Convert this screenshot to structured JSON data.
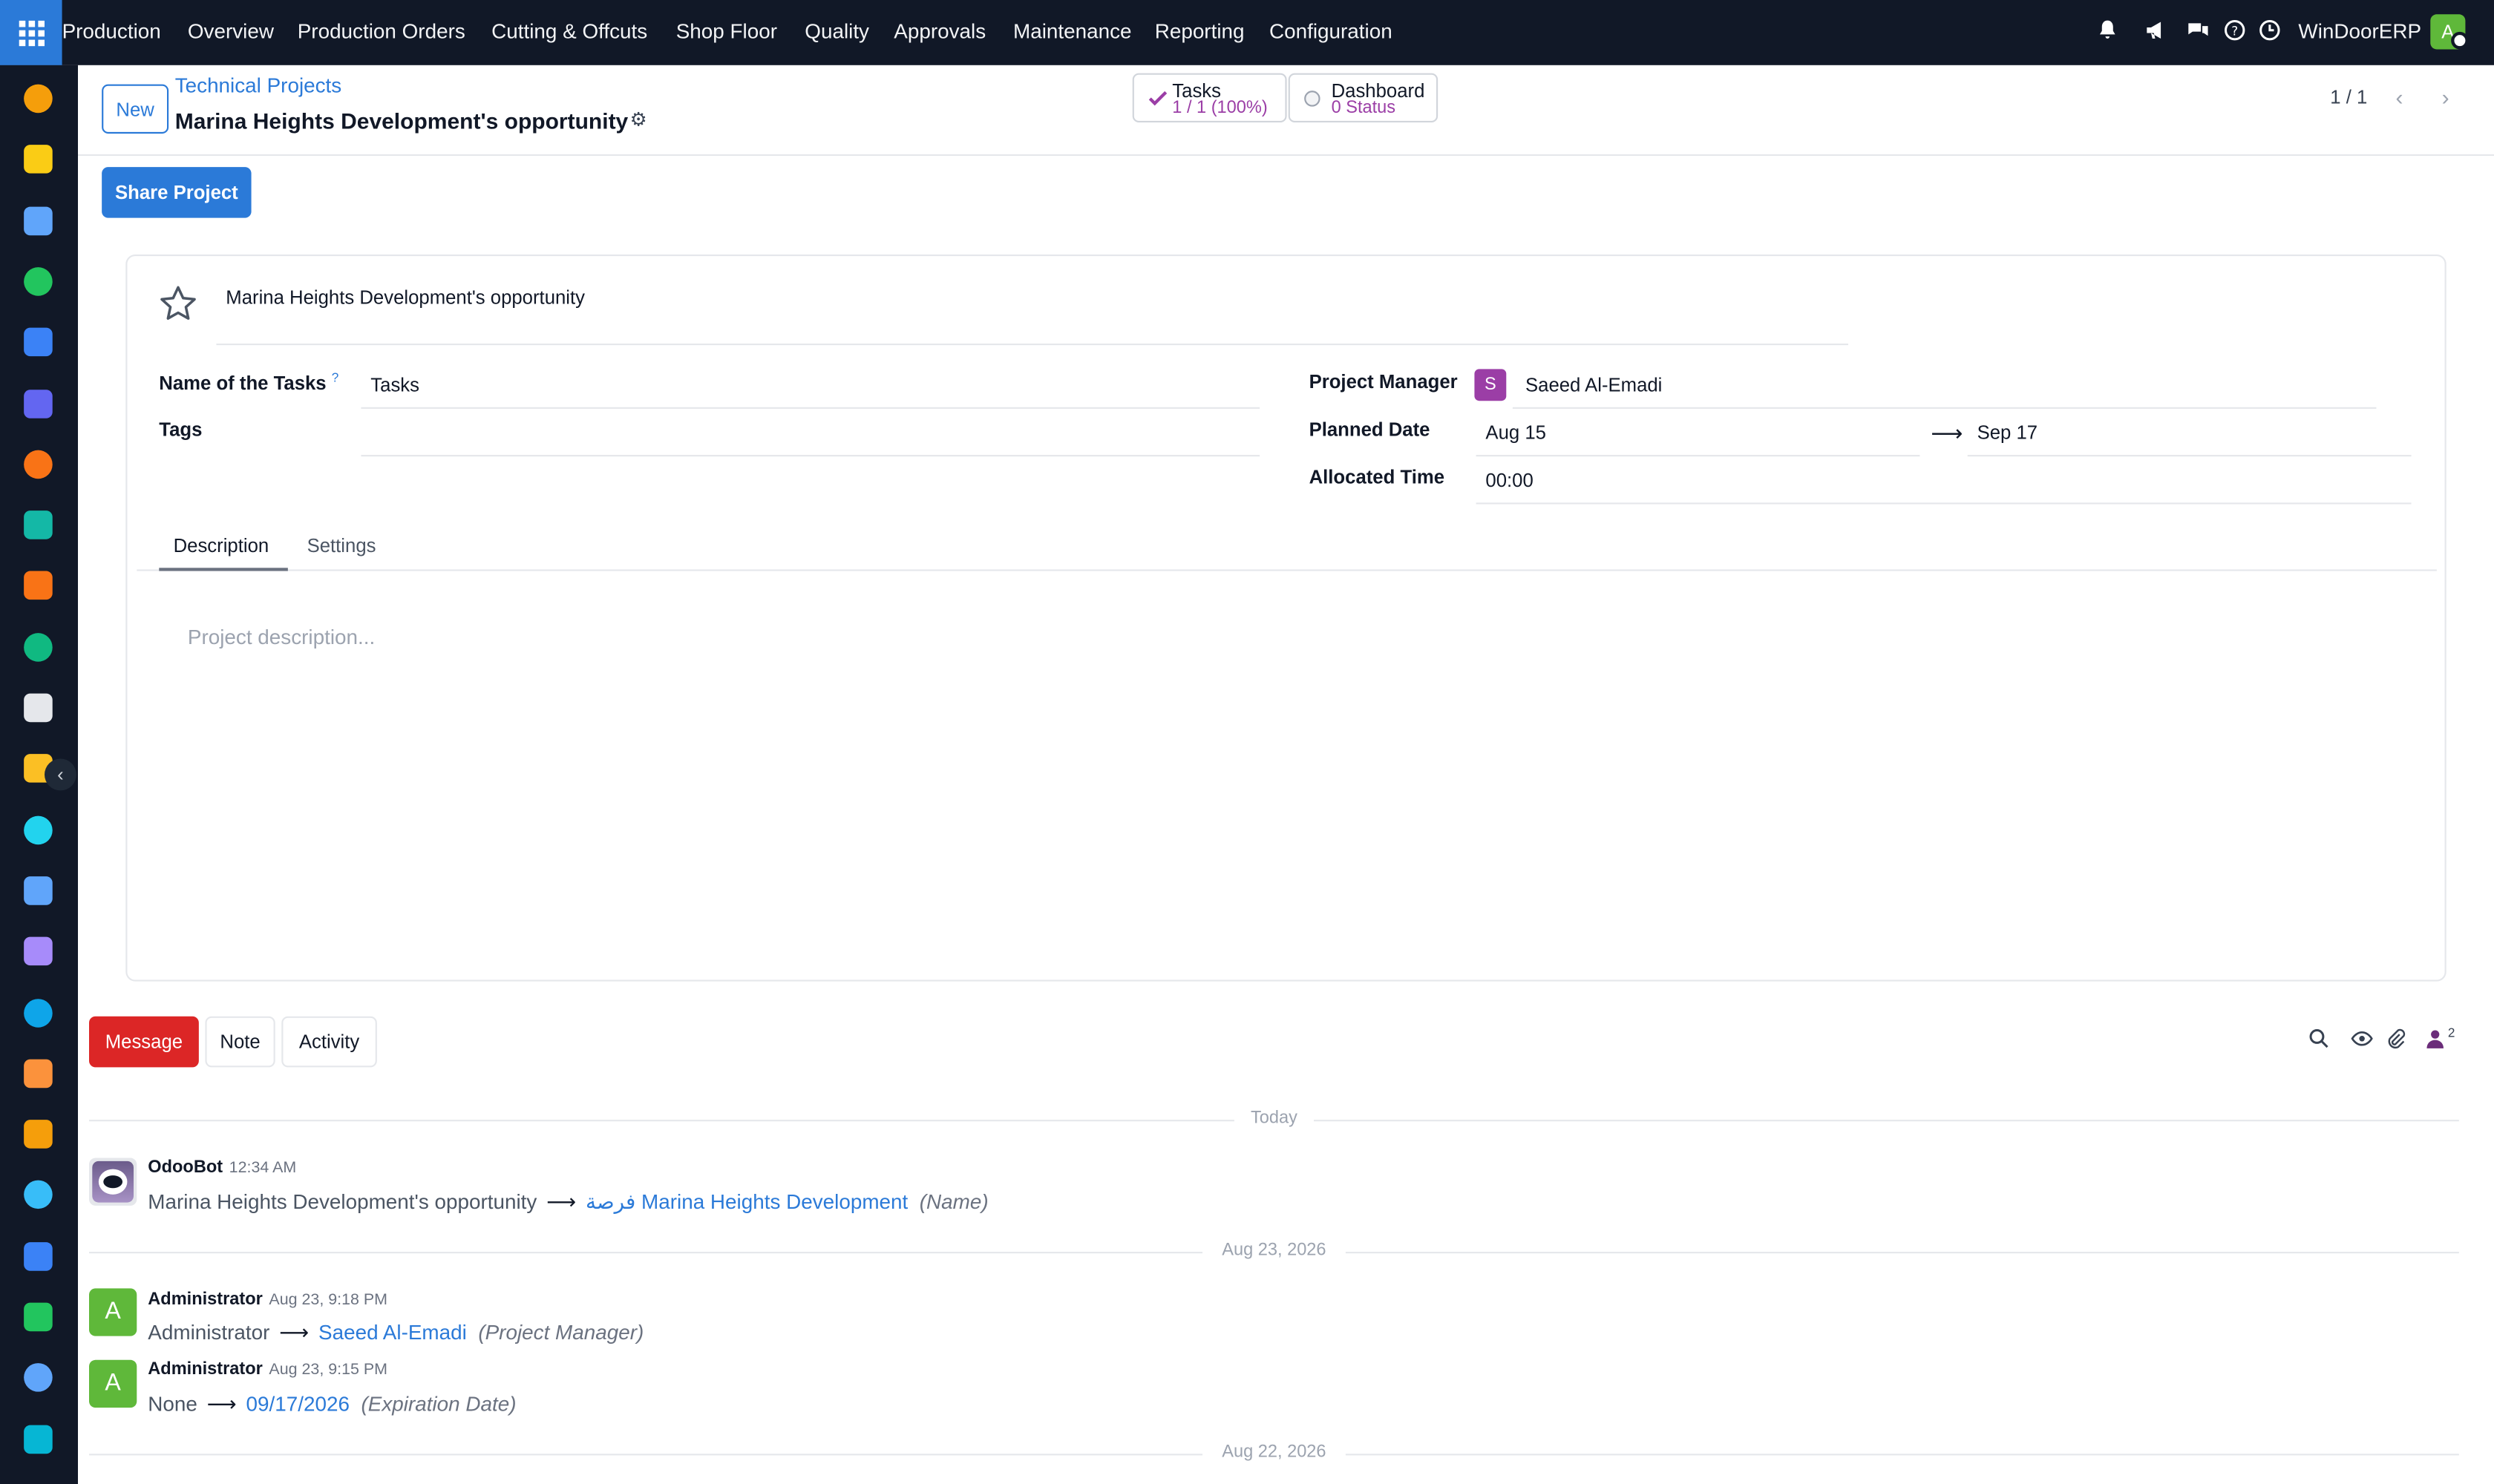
{
  "topbar": {
    "app_name": "Production",
    "menu": [
      "Overview",
      "Production Orders",
      "Cutting & Offcuts",
      "Shop Floor",
      "Quality",
      "Approvals",
      "Maintenance",
      "Reporting",
      "Configuration"
    ],
    "company": "WinDoorERP",
    "user_initial": "A",
    "icons": [
      "bell-icon",
      "megaphone-icon",
      "chat-icon",
      "help-icon",
      "clock-icon"
    ]
  },
  "sidebar": {
    "icons": [
      "bar-chart-icon",
      "paper-plane-icon",
      "compass-icon",
      "whatsapp-icon",
      "dashboard-icon",
      "m-app-icon",
      "chat-bubble-icon",
      "diamond-icon",
      "chart-icon",
      "contacts-icon",
      "box-icon",
      "puzzle-icon",
      "check-icon",
      "book-icon",
      "cube-icon",
      "invoice-icon",
      "team-icon",
      "calendar-icon",
      "sign-icon",
      "grid-icon",
      "whatsapp-icon",
      "compass-icon",
      "wave-icon"
    ],
    "colors": [
      "#f59e0b",
      "#facc15",
      "#60a5fa",
      "#22c55e",
      "#3b82f6",
      "#6366f1",
      "#f97316",
      "#14b8a6",
      "#f97316",
      "#10b981",
      "#e5e7eb",
      "#fbbf24",
      "#22d3ee",
      "#60a5fa",
      "#a78bfa",
      "#0ea5e9",
      "#fb923c",
      "#f59e0b",
      "#38bdf8",
      "#3b82f6",
      "#22c55e",
      "#60a5fa",
      "#06b6d4"
    ],
    "toggle_glyph": "‹"
  },
  "control_panel": {
    "new_label": "New",
    "breadcrumb": "Technical Projects",
    "title": "Marina Heights Development's opportunity",
    "smart_buttons": [
      {
        "label": "Tasks",
        "value": "1 / 1 (100%)"
      },
      {
        "label": "Dashboard",
        "value": "0 Status"
      }
    ],
    "pager": "1 / 1"
  },
  "actions": {
    "share_label": "Share Project"
  },
  "form": {
    "project_name": "Marina Heights Development's opportunity",
    "fields": {
      "tasks_label": "Name of the Tasks",
      "tasks_help": "?",
      "tasks_value": "Tasks",
      "tags_label": "Tags",
      "tags_value": "",
      "manager_label": "Project Manager",
      "manager_initial": "S",
      "manager_value": "Saeed Al-Emadi",
      "planned_label": "Planned Date",
      "planned_start": "Aug 15",
      "planned_end": "Sep 17",
      "allocated_label": "Allocated Time",
      "allocated_value": "00:00"
    },
    "tabs": [
      "Description",
      "Settings"
    ],
    "description_placeholder": "Project description..."
  },
  "chatter": {
    "buttons": [
      "Message",
      "Note",
      "Activity"
    ],
    "follower_count": "2",
    "separators": [
      "Today",
      "Aug 23, 2026",
      "Aug 22, 2026"
    ],
    "messages": [
      {
        "author": "OdooBot",
        "date": "12:34 AM",
        "old": "Marina Heights Development's opportunity",
        "new": "فرصة Marina Heights Development",
        "field": "(Name)"
      },
      {
        "author": "Administrator",
        "initial": "A",
        "date": "Aug 23, 9:18 PM",
        "old": "Administrator",
        "new": "Saeed Al-Emadi",
        "field": "(Project Manager)"
      },
      {
        "author": "Administrator",
        "initial": "A",
        "date": "Aug 23, 9:15 PM",
        "old": "None",
        "new": "09/17/2026",
        "field": "(Expiration Date)"
      }
    ]
  }
}
